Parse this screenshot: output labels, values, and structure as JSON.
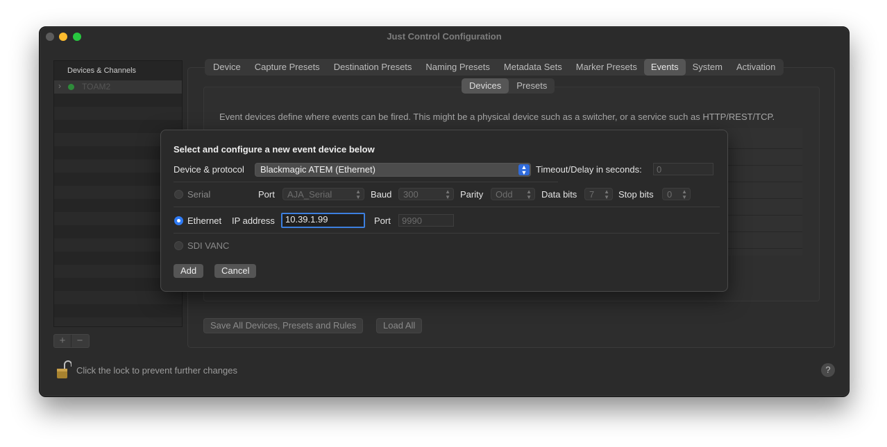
{
  "window": {
    "title": "Just Control Configuration"
  },
  "sidebar": {
    "header": "Devices & Channels",
    "items": [
      {
        "label": "TOAM2",
        "status_color": "#2e8b3a"
      }
    ],
    "add_label": "+",
    "remove_label": "−"
  },
  "tabs": [
    {
      "label": "Device"
    },
    {
      "label": "Capture Presets"
    },
    {
      "label": "Destination Presets"
    },
    {
      "label": "Naming Presets"
    },
    {
      "label": "Metadata Sets"
    },
    {
      "label": "Marker Presets"
    },
    {
      "label": "Events",
      "active": true
    },
    {
      "label": "System"
    },
    {
      "label": "Activation"
    }
  ],
  "subtabs": [
    {
      "label": "Devices",
      "active": true
    },
    {
      "label": "Presets"
    }
  ],
  "events": {
    "description": "Event devices define where events can be fired. This might be a physical device such as a switcher, or a service such as HTTP/REST/TCP."
  },
  "footer": {
    "save_all_label": "Save All Devices, Presets and Rules",
    "load_all_label": "Load All",
    "lock_text": "Click the lock to prevent further changes",
    "help_label": "?"
  },
  "dialog": {
    "title": "Select and configure a new event device below",
    "device_protocol_label": "Device & protocol",
    "device_protocol_value": "Blackmagic ATEM (Ethernet)",
    "timeout_label": "Timeout/Delay in seconds:",
    "timeout_placeholder": "0",
    "serial": {
      "label": "Serial",
      "port_label": "Port",
      "port_value": "AJA_Serial",
      "baud_label": "Baud",
      "baud_value": "300",
      "parity_label": "Parity",
      "parity_value": "Odd",
      "databits_label": "Data bits",
      "databits_value": "7",
      "stopbits_label": "Stop bits",
      "stopbits_value": "0"
    },
    "ethernet": {
      "label": "Ethernet",
      "ip_label": "IP address",
      "ip_value": "10.39.1.99",
      "port_label": "Port",
      "port_placeholder": "9990"
    },
    "sdi": {
      "label": "SDI VANC"
    },
    "add_label": "Add",
    "cancel_label": "Cancel"
  },
  "colors": {
    "accent": "#2f7bf5",
    "window_bg": "#2b2b2b"
  }
}
